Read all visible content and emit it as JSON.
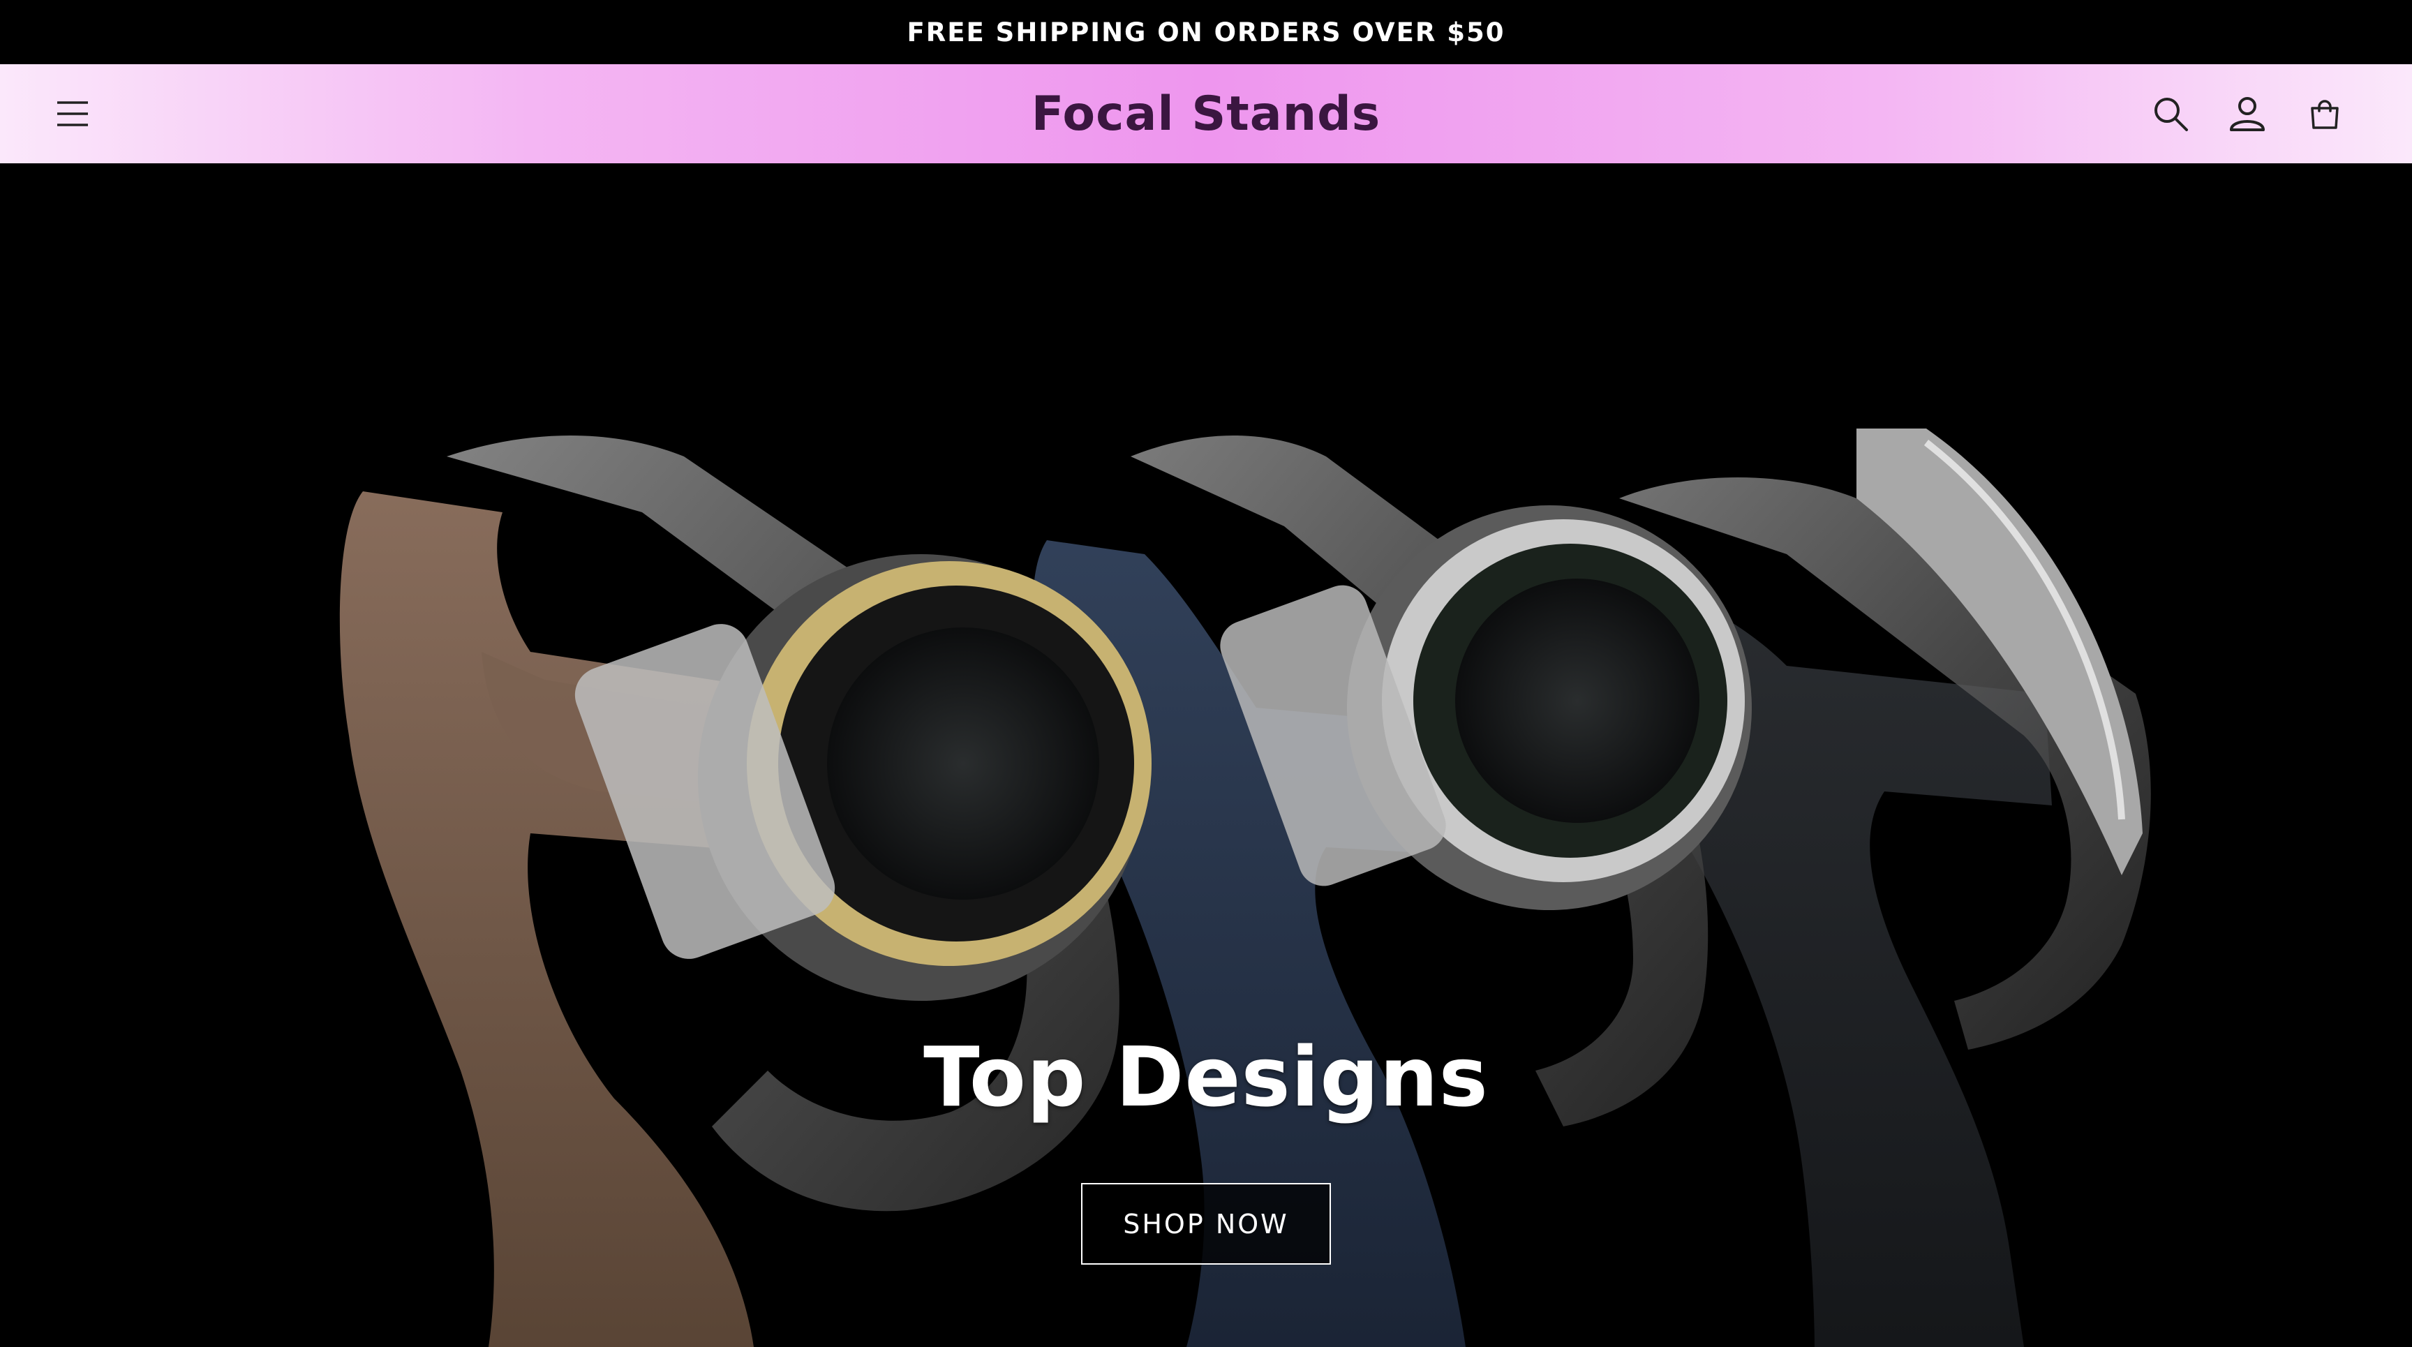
{
  "announcement": {
    "text": "FREE SHIPPING ON ORDERS OVER $50"
  },
  "header": {
    "brand": "Focal Stands",
    "icons": {
      "menu": "menu-icon",
      "search": "search-icon",
      "account": "account-icon",
      "cart": "cart-icon"
    }
  },
  "hero": {
    "title": "Top Designs",
    "cta_label": "SHOP NOW"
  },
  "colors": {
    "announcement_bg": "#000000",
    "header_gradient_center": "#ee96ee",
    "header_gradient_edge": "#fbe8fb",
    "brand_text": "#3a1640",
    "hero_bg": "#000000"
  }
}
